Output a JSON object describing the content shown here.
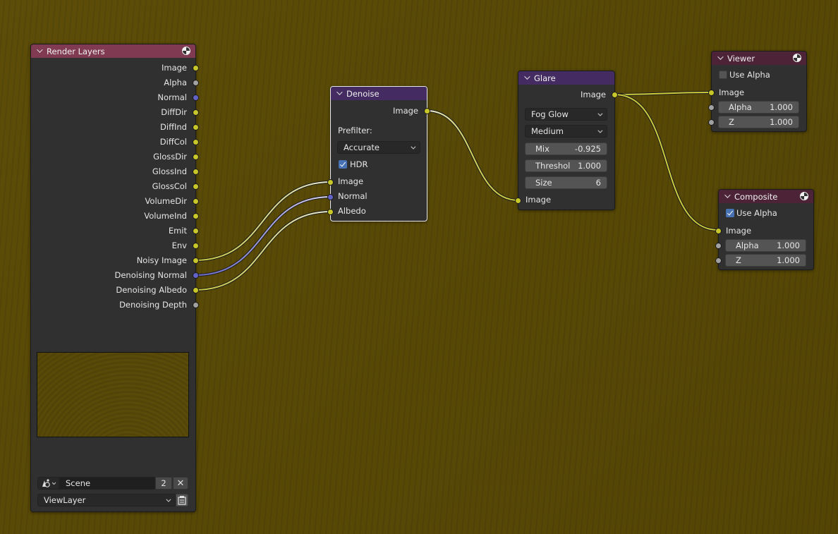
{
  "editor": {
    "background_color": "#5a4b07",
    "socket_colors": {
      "color": "#c7c729",
      "value": "#a1a1a1",
      "vector": "#6363c7"
    }
  },
  "nodes": {
    "render_layers": {
      "title": "Render Layers",
      "header_color": "#803a51",
      "outputs": [
        {
          "label": "Image",
          "type": "color"
        },
        {
          "label": "Alpha",
          "type": "value"
        },
        {
          "label": "Normal",
          "type": "vector"
        },
        {
          "label": "DiffDir",
          "type": "color"
        },
        {
          "label": "DiffInd",
          "type": "color"
        },
        {
          "label": "DiffCol",
          "type": "color"
        },
        {
          "label": "GlossDir",
          "type": "color"
        },
        {
          "label": "GlossInd",
          "type": "color"
        },
        {
          "label": "GlossCol",
          "type": "color"
        },
        {
          "label": "VolumeDir",
          "type": "color"
        },
        {
          "label": "VolumeInd",
          "type": "color"
        },
        {
          "label": "Emit",
          "type": "color"
        },
        {
          "label": "Env",
          "type": "color"
        },
        {
          "label": "Noisy Image",
          "type": "color"
        },
        {
          "label": "Denoising Normal",
          "type": "vector"
        },
        {
          "label": "Denoising Albedo",
          "type": "color"
        },
        {
          "label": "Denoising Depth",
          "type": "value"
        }
      ],
      "scene_field": "Scene",
      "scene_users": "2",
      "view_layer": "ViewLayer"
    },
    "denoise": {
      "title": "Denoise",
      "header_color": "#442c62",
      "outputs": [
        {
          "label": "Image",
          "type": "color"
        }
      ],
      "prefilter_label": "Prefilter:",
      "prefilter_value": "Accurate",
      "hdr_label": "HDR",
      "hdr_checked": true,
      "inputs": [
        {
          "label": "Image",
          "type": "color"
        },
        {
          "label": "Normal",
          "type": "vector"
        },
        {
          "label": "Albedo",
          "type": "color"
        }
      ]
    },
    "glare": {
      "title": "Glare",
      "header_color": "#442c62",
      "outputs": [
        {
          "label": "Image",
          "type": "color"
        }
      ],
      "glare_type": "Fog Glow",
      "quality": "Medium",
      "fields": [
        {
          "label": "Mix",
          "value": "-0.925"
        },
        {
          "label": "Threshol",
          "value": "1.000"
        },
        {
          "label": "Size",
          "value": "6"
        }
      ],
      "inputs": [
        {
          "label": "Image",
          "type": "color"
        }
      ]
    },
    "viewer": {
      "title": "Viewer",
      "header_color": "#4d2337",
      "use_alpha_label": "Use Alpha",
      "use_alpha_checked": false,
      "inputs": [
        {
          "label": "Image",
          "type": "color"
        },
        {
          "label": "Alpha",
          "value": "1.000",
          "type": "value"
        },
        {
          "label": "Z",
          "value": "1.000",
          "type": "value"
        }
      ]
    },
    "composite": {
      "title": "Composite",
      "header_color": "#4d2337",
      "use_alpha_label": "Use Alpha",
      "use_alpha_checked": true,
      "inputs": [
        {
          "label": "Image",
          "type": "color"
        },
        {
          "label": "Alpha",
          "value": "1.000",
          "type": "value"
        },
        {
          "label": "Z",
          "value": "1.000",
          "type": "value"
        }
      ]
    }
  },
  "links": [
    {
      "from": "Render Layers.Noisy Image",
      "to": "Denoise.Image"
    },
    {
      "from": "Render Layers.Denoising Normal",
      "to": "Denoise.Normal"
    },
    {
      "from": "Render Layers.Denoising Albedo",
      "to": "Denoise.Albedo"
    },
    {
      "from": "Denoise.Image",
      "to": "Glare.Image"
    },
    {
      "from": "Glare.Image",
      "to": "Viewer.Image"
    },
    {
      "from": "Glare.Image",
      "to": "Composite.Image"
    }
  ]
}
